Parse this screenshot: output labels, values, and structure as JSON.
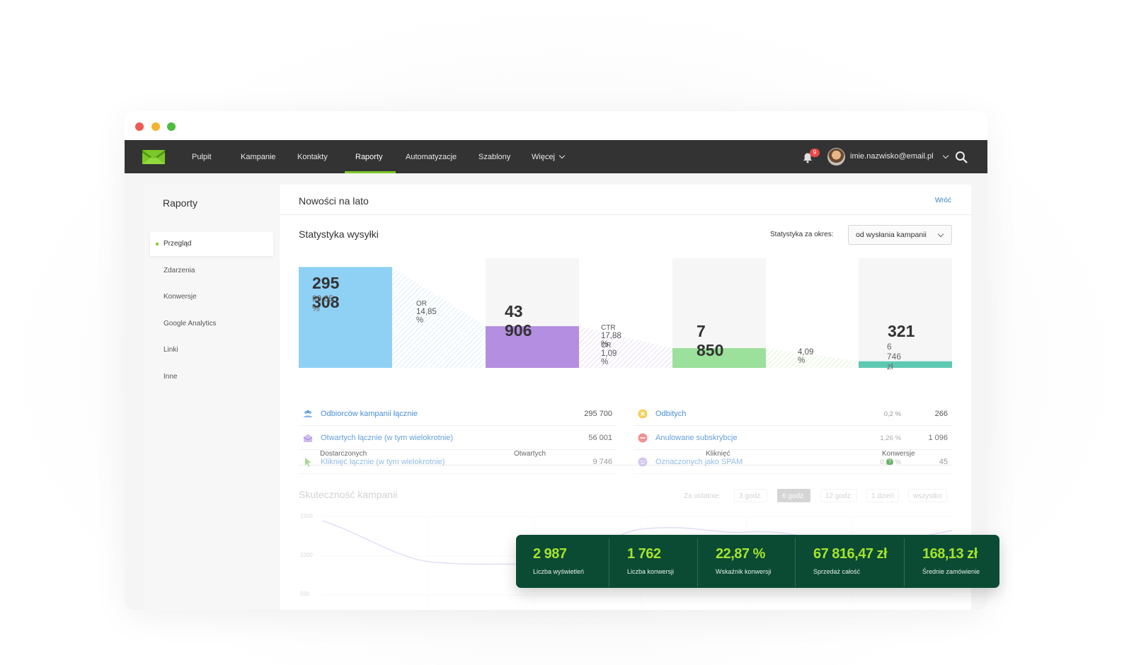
{
  "nav": {
    "items": [
      "Pulpit",
      "Kampanie",
      "Kontakty",
      "Raporty",
      "Automatyzacje",
      "Szablony",
      "Więcej"
    ],
    "notification_count": "9",
    "user_email": "imie.nazwisko@email.pl"
  },
  "sidebar": {
    "title": "Raporty",
    "items": [
      "Przegląd",
      "Zdarzenia",
      "Konwersje",
      "Google Analytics",
      "Linki",
      "Inne"
    ]
  },
  "main": {
    "title": "Nowości na lato",
    "back_label": "Wróć",
    "section_title": "Statystyka wysyłki",
    "period_label": "Statystyka za okres:",
    "period_value": "od wysłania kampanii"
  },
  "funnel": {
    "delivered": {
      "value": "295 308",
      "percent": "99,85 %",
      "label": "Dostarczonych",
      "fraction": 0.92
    },
    "or_label": "OR",
    "or_value": "14,85 %",
    "opened": {
      "value": "43 906",
      "label": "Otwartych",
      "fraction": 0.38
    },
    "ctr_label": "CTR",
    "ctr_value": "17,88 %",
    "cr_label": "CR",
    "cr_value": "1,09 %",
    "clicked": {
      "value": "7 850",
      "label": "Kliknięć",
      "fraction": 0.18
    },
    "conv_rate": "4,09 %",
    "conversions": {
      "value": "321",
      "amount": "6 746 zł",
      "label": "Konwersje",
      "fraction": 0.06
    },
    "colors": {
      "delivered": "#8fd0f5",
      "opened": "#b48ee0",
      "clicked": "#9be09b",
      "conversions": "#5ec9b2"
    }
  },
  "stats_left": [
    {
      "label": "Odbiorców kampanii łącznie",
      "value": "295 700",
      "icon": "users-icon"
    },
    {
      "label": "Otwartych łącznie (w tym wielokrotnie)",
      "value": "56 001",
      "icon": "open-envelope-icon"
    },
    {
      "label": "Kliknięć łącznie (w tym wielokrotnie)",
      "value": "9 746",
      "icon": "cursor-icon"
    }
  ],
  "stats_right": [
    {
      "label": "Odbitych",
      "percent": "0,2 %",
      "value": "266",
      "icon": "bounce-icon"
    },
    {
      "label": "Anulowane subskrybcje",
      "percent": "1,26 %",
      "value": "1 096",
      "icon": "unsubscribe-icon"
    },
    {
      "label": "Oznaczonych jako SPAM",
      "percent": "0,23 %",
      "value": "45",
      "icon": "spam-icon"
    }
  ],
  "effectiveness": {
    "title": "Skuteczność kampanii",
    "range_label": "Za ostatnie:",
    "ranges": [
      "3 godz.",
      "6 godz.",
      "12 godz.",
      "1 dzień",
      "wszystko"
    ],
    "active_range": "6 godz.",
    "y_ticks": [
      "1500",
      "1000",
      "500"
    ]
  },
  "kpis": [
    {
      "value": "2 987",
      "label": "Liczba wyświetleń"
    },
    {
      "value": "1 762",
      "label": "Liczba konwersji"
    },
    {
      "value": "22,87 %",
      "label": "Wskaźnik konwersji"
    },
    {
      "value": "67 816,47 zł",
      "label": "Sprzedaż całość"
    },
    {
      "value": "168,13 zł",
      "label": "Średnie zamówienie"
    }
  ]
}
